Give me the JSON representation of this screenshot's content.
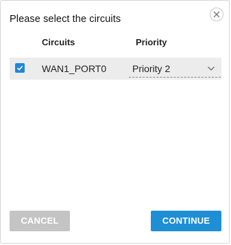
{
  "dialog": {
    "title": "Please select the circuits"
  },
  "table": {
    "headers": {
      "circuits": "Circuits",
      "priority": "Priority"
    },
    "rows": [
      {
        "checked": true,
        "circuit": "WAN1_PORT0",
        "priority": "Priority 2"
      }
    ]
  },
  "buttons": {
    "cancel": "CANCEL",
    "continue": "CONTINUE"
  },
  "colors": {
    "accent": "#1e8fd4",
    "disabled": "#c4c4c4",
    "row_background": "#ececec"
  },
  "icons": {
    "close": "close-icon",
    "checkbox": "checkmark-icon",
    "dropdown": "chevron-down-icon"
  }
}
